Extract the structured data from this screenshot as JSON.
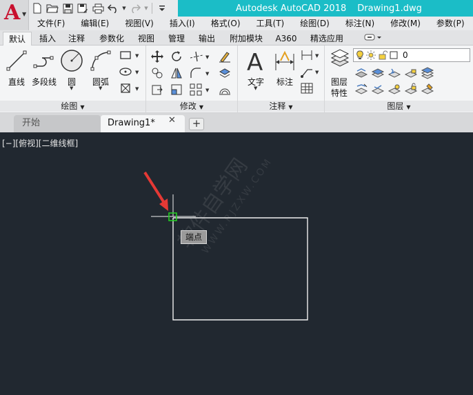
{
  "title": {
    "app_name": "Autodesk AutoCAD 2018",
    "document": "Drawing1.dwg"
  },
  "menus": [
    "文件(F)",
    "编辑(E)",
    "视图(V)",
    "插入(I)",
    "格式(O)",
    "工具(T)",
    "绘图(D)",
    "标注(N)",
    "修改(M)",
    "参数(P)"
  ],
  "ribbon_tabs": [
    "默认",
    "插入",
    "注释",
    "参数化",
    "视图",
    "管理",
    "输出",
    "附加模块",
    "A360",
    "精选应用"
  ],
  "panels": {
    "draw": {
      "title": "绘图",
      "line": "直线",
      "polyline": "多段线",
      "circle": "圆",
      "arc": "圆弧"
    },
    "modify": {
      "title": "修改"
    },
    "annotation": {
      "title": "注释",
      "text": "文字",
      "dimension": "标注"
    },
    "layers": {
      "title": "图层",
      "layer_properties_line1": "图层",
      "layer_properties_line2": "特性",
      "current_layer": "0"
    }
  },
  "file_tabs": {
    "start": "开始",
    "drawing": "Drawing1*"
  },
  "canvas": {
    "viewport_label": "[−][俯视][二维线框]",
    "tooltip": "端点",
    "watermark": "软件自学网",
    "watermark_url": "WWW.RJZXW.COM"
  },
  "colors": {
    "title_accent": "#1bbdc7",
    "canvas_bg": "#212830",
    "snap_marker": "#22cc22",
    "arrow": "#e53935"
  }
}
